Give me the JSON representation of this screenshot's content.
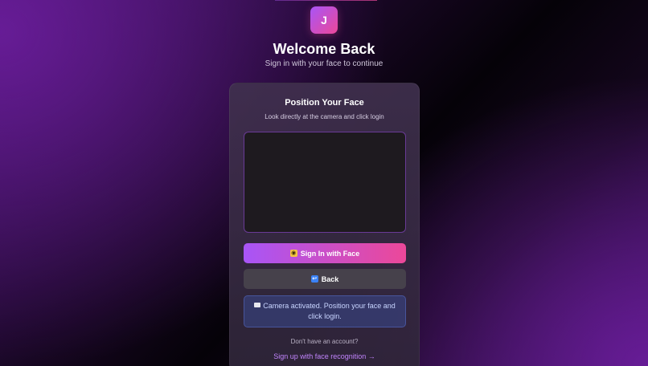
{
  "logo": {
    "letter": "J"
  },
  "header": {
    "title": "Welcome Back",
    "subtitle": "Sign in with your face to continue"
  },
  "card": {
    "title": "Position Your Face",
    "subtitle": "Look directly at the camera and click login",
    "primary_button": {
      "label": "Sign In with Face",
      "icon": "camera-icon"
    },
    "secondary_button": {
      "label": "Back",
      "icon": "back-arrow-icon"
    },
    "status": {
      "icon": "camera-icon",
      "text": "Camera activated. Position your face and click login."
    },
    "signup_prompt": "Don't have an account?",
    "signup_link": "Sign up with face recognition →"
  },
  "colors": {
    "accent_start": "#a855f7",
    "accent_end": "#ec4899",
    "link": "#c084fc",
    "status_bg": "#3b50a0"
  }
}
